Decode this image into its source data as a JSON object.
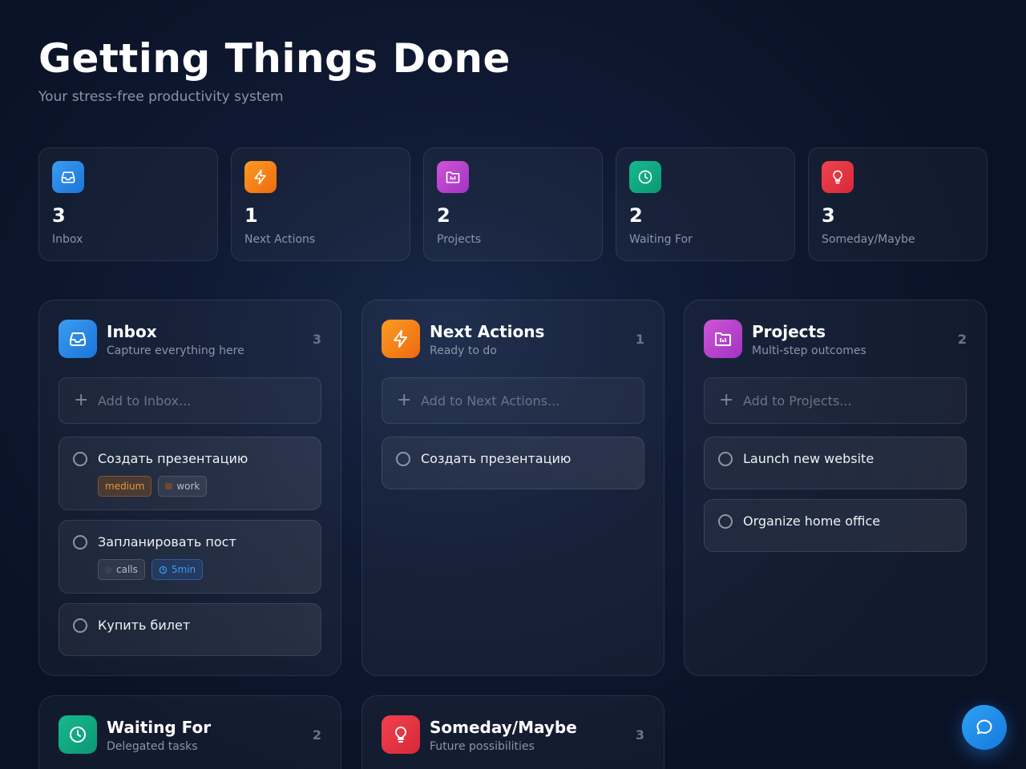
{
  "header": {
    "title": "Getting Things Done",
    "subtitle": "Your stress-free productivity system"
  },
  "stats": [
    {
      "value": "3",
      "label": "Inbox",
      "icon": "inbox-icon",
      "color": "#2b8ae6"
    },
    {
      "value": "1",
      "label": "Next Actions",
      "icon": "lightning-icon",
      "color": "#f5821a"
    },
    {
      "value": "2",
      "label": "Projects",
      "icon": "folder-icon",
      "color": "#b844cc"
    },
    {
      "value": "2",
      "label": "Waiting For",
      "icon": "clock-icon",
      "color": "#12a882"
    },
    {
      "value": "3",
      "label": "Someday/Maybe",
      "icon": "lightbulb-icon",
      "color": "#e53543"
    }
  ],
  "panels": {
    "inbox": {
      "title": "Inbox",
      "description": "Capture everything here",
      "count": "3",
      "add_placeholder": "Add to Inbox...",
      "tasks": [
        {
          "text": "Создать презентацию",
          "tags": {
            "priority": "medium",
            "context": "work"
          }
        },
        {
          "text": "Запланировать пост",
          "tags": {
            "context": "calls",
            "time": "5min"
          }
        },
        {
          "text": "Купить билет"
        }
      ]
    },
    "next_actions": {
      "title": "Next Actions",
      "description": "Ready to do",
      "count": "1",
      "add_placeholder": "Add to Next Actions...",
      "tasks": [
        {
          "text": "Создать презентацию"
        }
      ]
    },
    "projects": {
      "title": "Projects",
      "description": "Multi-step outcomes",
      "count": "2",
      "add_placeholder": "Add to Projects...",
      "tasks": [
        {
          "text": "Launch new website"
        },
        {
          "text": "Organize home office"
        }
      ]
    },
    "waiting_for": {
      "title": "Waiting For",
      "description": "Delegated tasks",
      "count": "2"
    },
    "someday": {
      "title": "Someday/Maybe",
      "description": "Future possibilities",
      "count": "3"
    }
  },
  "colors": {
    "accent": "#2b8ae6",
    "background": "#0f1a33"
  }
}
